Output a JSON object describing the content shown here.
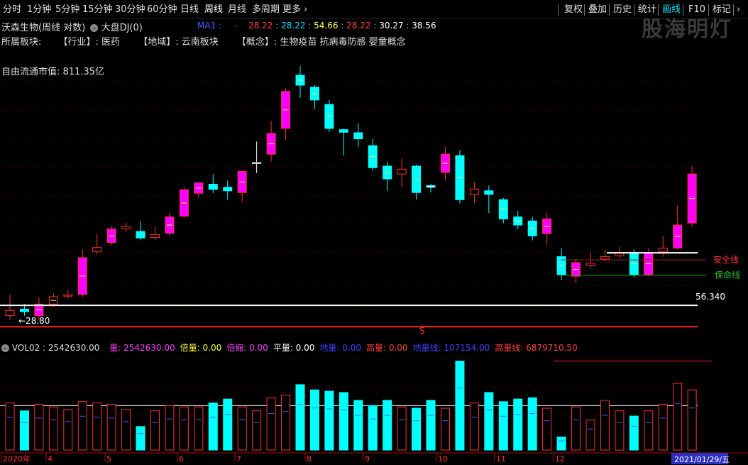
{
  "toolbar": {
    "periods": [
      "分时",
      "1分钟",
      "5分钟",
      "15分钟",
      "30分钟",
      "60分钟",
      "日线",
      "周线",
      "月线",
      "多周期",
      "更多"
    ],
    "active_period": "周线",
    "right_buttons": [
      "复权",
      "叠加",
      "历史",
      "统计",
      "画线",
      "F10",
      "标记"
    ],
    "highlighted_right": "画线"
  },
  "watermark": "股海明灯",
  "stock": {
    "title": "沃森生物(周线 对数)",
    "index_label": "大盘DJ(0)",
    "ma_label": "MA1 :",
    "ma_value_dash": "-",
    "ma_values": [
      {
        "text": "28.22",
        "color": "#ff4040"
      },
      {
        "text": "28.22",
        "color": "#00e5ff"
      },
      {
        "text": "54.66",
        "color": "#ffff40"
      },
      {
        "text": "28.22",
        "color": "#ff4040"
      },
      {
        "text": "30.27",
        "color": "#ffffff"
      },
      {
        "text": "38.56",
        "color": "#ffffff"
      }
    ],
    "sector_label": "所属板块:",
    "industry": "【行业】: 医药",
    "region": "【地域】: 云南板块",
    "concept": "【概念】: 生物疫苗 抗病毒防感 婴童概念",
    "market_cap": "自由流通市值: 811.35亿"
  },
  "price_chart": {
    "y_log": true,
    "annotations": {
      "low_label": "←28.80",
      "line_value": "56.340",
      "safety_line": "安全线",
      "life_line": "保命线",
      "marker": "S"
    }
  },
  "chart_data": {
    "type": "candlestick",
    "candles": [
      {
        "o": 29.6,
        "c": 30.4,
        "h": 33.0,
        "l": 29.0
      },
      {
        "o": 30.6,
        "c": 30.2,
        "h": 31.4,
        "l": 29.6
      },
      {
        "o": 29.6,
        "c": 31.4,
        "h": 32.5,
        "l": 28.8
      },
      {
        "o": 31.4,
        "c": 32.6,
        "h": 33.2,
        "l": 31.0
      },
      {
        "o": 32.7,
        "c": 32.9,
        "h": 33.8,
        "l": 32.3
      },
      {
        "o": 33.0,
        "c": 39.8,
        "h": 41.5,
        "l": 32.6
      },
      {
        "o": 41.0,
        "c": 41.9,
        "h": 45.0,
        "l": 40.5
      },
      {
        "o": 43.0,
        "c": 46.1,
        "h": 46.8,
        "l": 42.3
      },
      {
        "o": 46.1,
        "c": 46.7,
        "h": 47.5,
        "l": 45.4
      },
      {
        "o": 45.5,
        "c": 44.0,
        "h": 47.9,
        "l": 43.5
      },
      {
        "o": 44.1,
        "c": 44.8,
        "h": 46.6,
        "l": 43.5
      },
      {
        "o": 45.1,
        "c": 49.0,
        "h": 50.0,
        "l": 44.6
      },
      {
        "o": 49.2,
        "c": 56.3,
        "h": 57.0,
        "l": 48.8
      },
      {
        "o": 55.3,
        "c": 58.3,
        "h": 58.3,
        "l": 54.0
      },
      {
        "o": 57.9,
        "c": 56.4,
        "h": 61.0,
        "l": 55.3
      },
      {
        "o": 57.0,
        "c": 56.0,
        "h": 59.0,
        "l": 53.5
      },
      {
        "o": 55.5,
        "c": 61.8,
        "h": 62.0,
        "l": 53.0
      },
      {
        "o": 64.5,
        "c": 64.7,
        "h": 72.0,
        "l": 61.3
      },
      {
        "o": 67.5,
        "c": 75.0,
        "h": 80.0,
        "l": 65.0
      },
      {
        "o": 77.0,
        "c": 93.0,
        "h": 94.5,
        "l": 72.5
      },
      {
        "o": 101.0,
        "c": 96.0,
        "h": 106.0,
        "l": 90.0
      },
      {
        "o": 95.0,
        "c": 89.0,
        "h": 96.0,
        "l": 85.0
      },
      {
        "o": 87.0,
        "c": 77.0,
        "h": 89.0,
        "l": 75.5
      },
      {
        "o": 76.5,
        "c": 75.5,
        "h": 77.0,
        "l": 67.0
      },
      {
        "o": 75.3,
        "c": 73.0,
        "h": 79.0,
        "l": 70.0
      },
      {
        "o": 70.5,
        "c": 63.0,
        "h": 73.0,
        "l": 62.0
      },
      {
        "o": 63.5,
        "c": 59.5,
        "h": 65.0,
        "l": 56.0
      },
      {
        "o": 61.0,
        "c": 62.5,
        "h": 66.0,
        "l": 57.0
      },
      {
        "o": 63.5,
        "c": 55.5,
        "h": 64.0,
        "l": 53.5
      },
      {
        "o": 57.5,
        "c": 57.0,
        "h": 58.0,
        "l": 55.5
      },
      {
        "o": 61.5,
        "c": 67.5,
        "h": 70.0,
        "l": 59.0
      },
      {
        "o": 67.0,
        "c": 53.5,
        "h": 69.0,
        "l": 52.5
      },
      {
        "o": 55.0,
        "c": 56.5,
        "h": 58.5,
        "l": 52.5
      },
      {
        "o": 56.0,
        "c": 55.0,
        "h": 57.5,
        "l": 50.0
      },
      {
        "o": 53.5,
        "c": 48.5,
        "h": 54.0,
        "l": 47.5
      },
      {
        "o": 49.0,
        "c": 47.0,
        "h": 50.5,
        "l": 46.0
      },
      {
        "o": 48.0,
        "c": 44.5,
        "h": 49.0,
        "l": 43.5
      },
      {
        "o": 45.0,
        "c": 48.5,
        "h": 50.0,
        "l": 42.5
      },
      {
        "o": 40.0,
        "c": 36.5,
        "h": 41.8,
        "l": 35.5
      },
      {
        "o": 36.2,
        "c": 38.8,
        "h": 39.5,
        "l": 35.0
      },
      {
        "o": 38.3,
        "c": 38.7,
        "h": 41.0,
        "l": 37.8
      },
      {
        "o": 39.5,
        "c": 40.0,
        "h": 41.5,
        "l": 39.0
      },
      {
        "o": 40.2,
        "c": 40.8,
        "h": 42.0,
        "l": 39.8
      },
      {
        "o": 40.8,
        "c": 36.5,
        "h": 41.5,
        "l": 36.0
      },
      {
        "o": 36.5,
        "c": 40.8,
        "h": 41.8,
        "l": 36.2
      },
      {
        "o": 41.0,
        "c": 41.8,
        "h": 44.5,
        "l": 40.0
      },
      {
        "o": 41.8,
        "c": 47.0,
        "h": 52.0,
        "l": 41.5
      },
      {
        "o": 47.5,
        "c": 61.0,
        "h": 63.5,
        "l": 46.5
      }
    ],
    "colors": {
      "up": "#ff3030",
      "up_fill": "#ff00ff",
      "down": "#00ffff",
      "flat": "#40ff40"
    },
    "ylim": [
      27.0,
      113.0
    ],
    "safety_line_value": 40.8,
    "life_line_value": 36.4,
    "support_value": 31.2,
    "low_value": 28.8
  },
  "volume": {
    "header": "VOL02 : 2542630.00",
    "items": [
      {
        "label": "量: 2542630.00",
        "color": "#ff40ff"
      },
      {
        "label": "倍量: 0.00",
        "color": "#ffff40"
      },
      {
        "label": "倍缩: 0.00",
        "color": "#ff40ff"
      },
      {
        "label": "平量: 0.00",
        "color": "#ffffff"
      },
      {
        "label": "地量: 0.00",
        "color": "#4040ff"
      },
      {
        "label": "高量: 0.00",
        "color": "#ff4040"
      },
      {
        "label": "地量线: 107154.00",
        "color": "#4040ff"
      },
      {
        "label": "高量线: 6879710.50",
        "color": "#ff4040"
      }
    ],
    "values": [
      3.6,
      3.0,
      3.5,
      3.3,
      3.1,
      3.7,
      3.6,
      3.5,
      3.1,
      1.8,
      3.0,
      3.4,
      3.3,
      3.3,
      3.6,
      3.9,
      3.3,
      3.0,
      4.0,
      4.2,
      5.0,
      4.6,
      4.5,
      4.4,
      3.8,
      3.4,
      3.8,
      3.3,
      3.2,
      3.8,
      3.2,
      2.5,
      3.6,
      4.4,
      3.7,
      3.9,
      4.0,
      3.2,
      1.0,
      3.3,
      2.3,
      3.8,
      3.0,
      2.6,
      3.0,
      3.5,
      5.1,
      4.6
    ],
    "xaxis": [
      "2020年",
      "4",
      "5",
      "6",
      "7",
      "8",
      "9",
      "10",
      "11",
      "12"
    ],
    "date_label": "2021/01/29/五"
  }
}
